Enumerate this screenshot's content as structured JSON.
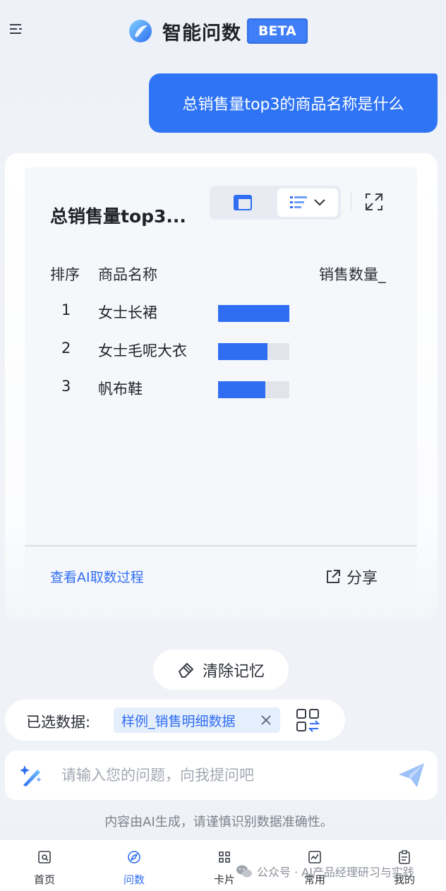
{
  "header": {
    "title": "智能问数",
    "badge": "BETA"
  },
  "question": "总销售量top3的商品名称是什么",
  "answer_card": {
    "title": "总销售量top3...",
    "columns": [
      "排序",
      "商品名称",
      "销售数量_"
    ],
    "rows": [
      {
        "rank": "1",
        "name": "女士长裙",
        "bar_fraction": 1.0
      },
      {
        "rank": "2",
        "name": "女士毛呢大衣",
        "bar_fraction": 0.69
      },
      {
        "rank": "3",
        "name": "帆布鞋",
        "bar_fraction": 0.66
      }
    ],
    "process_link": "查看AI取数过程",
    "share_label": "分享"
  },
  "clear_memory_label": "清除记忆",
  "selected_data": {
    "label": "已选数据:",
    "chip": "样例_销售明细数据"
  },
  "input": {
    "placeholder": "请输入您的问题，向我提问吧"
  },
  "disclaimer": "内容由AI生成，请谨慎识别数据准确性。",
  "tabs": [
    {
      "label": "首页",
      "icon": "home-search-icon",
      "active": false
    },
    {
      "label": "问数",
      "icon": "compass-icon",
      "active": true
    },
    {
      "label": "卡片",
      "icon": "grid-icon",
      "active": false
    },
    {
      "label": "常用",
      "icon": "chart-icon",
      "active": false
    },
    {
      "label": "我的",
      "icon": "clipboard-icon",
      "active": false
    }
  ],
  "watermark": "公众号 · AI产品经理研习与实践",
  "colors": {
    "accent": "#2f6ef3",
    "bubble": "#2f74f5",
    "bar_track": "#e1e4ea"
  }
}
